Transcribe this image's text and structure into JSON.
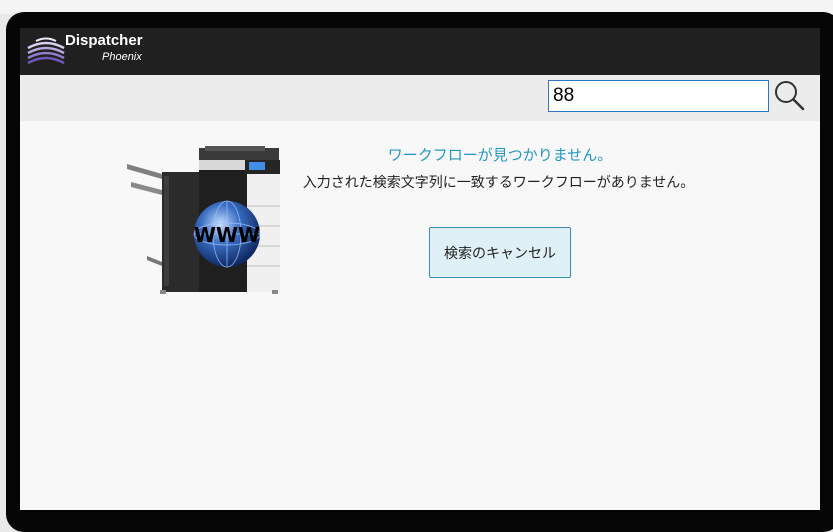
{
  "app": {
    "brand_name": "Dispatcher",
    "brand_sub": "Phoenix"
  },
  "search": {
    "value": "88"
  },
  "message": {
    "title": "ワークフローが見つかりません。",
    "body": "入力された検索文字列に一致するワークフローがありません。"
  },
  "actions": {
    "cancel_search_label": "検索のキャンセル"
  },
  "icons": {
    "search": "magnifier-icon",
    "illustration": "printer-www-icon",
    "globe_text": "WWW"
  },
  "colors": {
    "header_bg": "#202020",
    "accent_blue": "#2596c4",
    "button_bg": "#dff0f7",
    "input_border": "#2a77c7"
  }
}
